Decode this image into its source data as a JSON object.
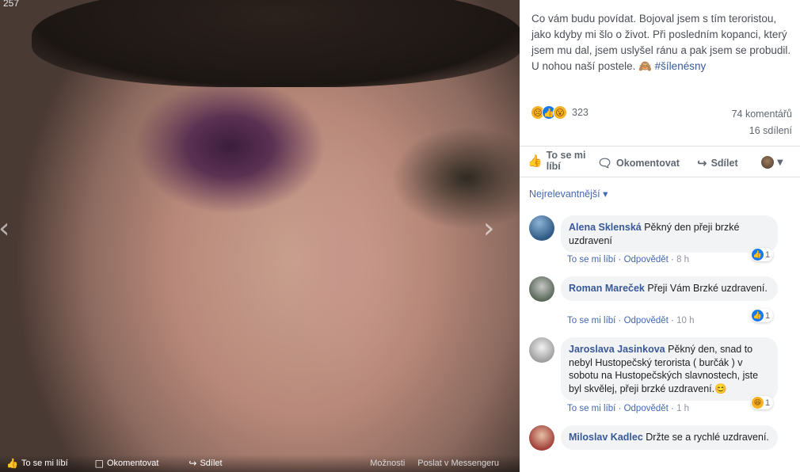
{
  "viewer": {
    "counter": "257",
    "prev_arrow": "‹",
    "next_arrow": "›",
    "bottom": {
      "like": "To se mi líbí",
      "comment": "Okomentovat",
      "share": "Sdílet",
      "options": "Možnosti",
      "messenger": "Poslat v Messengeru"
    }
  },
  "post": {
    "caption": "Co vám budu povídat. Bojoval jsem s tím teroristou, jako kdyby mi šlo o život. Při posledním kopanci, který jsem mu dal, jsem uslyšel ránu a pak jsem se probudil. U nohou naší postele. 🙈",
    "hashtag": "#šílenésny",
    "reactions_count": "323",
    "reaction_icons": [
      "sad-icon",
      "like-icon",
      "wow-icon"
    ],
    "comments_count": "74 komentářů",
    "shares_count": "16 sdílení",
    "actions": {
      "like": "To se mi líbí",
      "comment": "Okomentovat",
      "share": "Sdílet"
    },
    "sort_label": "Nejrelevantnější ▾"
  },
  "comments": [
    {
      "name": "Alena Sklenská",
      "text": "Pěkný den přeji brzké uzdravení",
      "like": "To se mi líbí",
      "reply": "Odpovědět",
      "time": "8 h",
      "reaction_count": "1",
      "reaction_icon": "like-icon"
    },
    {
      "name": "Roman Mareček",
      "text": "Přeji Vám Brzké uzdravení.",
      "like": "To se mi líbí",
      "reply": "Odpovědět",
      "time": "10 h",
      "reaction_count": "1",
      "reaction_icon": "like-icon"
    },
    {
      "name": "Jaroslava Jasinkova",
      "text": "Pěkný den, snad to nebyl Hustopečský terorista ( burčák ) v sobotu na Hustopečských slavnostech, jste byl skvělej, přeji brzké uzdravení.😊",
      "like": "To se mi líbí",
      "reply": "Odpovědět",
      "time": "1 h",
      "reaction_count": "1",
      "reaction_icon": "haha-icon"
    },
    {
      "name": "Miloslav Kadlec",
      "text": "Držte se a rychlé uzdravení."
    }
  ],
  "colors": {
    "link": "#385898",
    "accent": "#4267b2",
    "bubble": "#f2f3f5"
  }
}
